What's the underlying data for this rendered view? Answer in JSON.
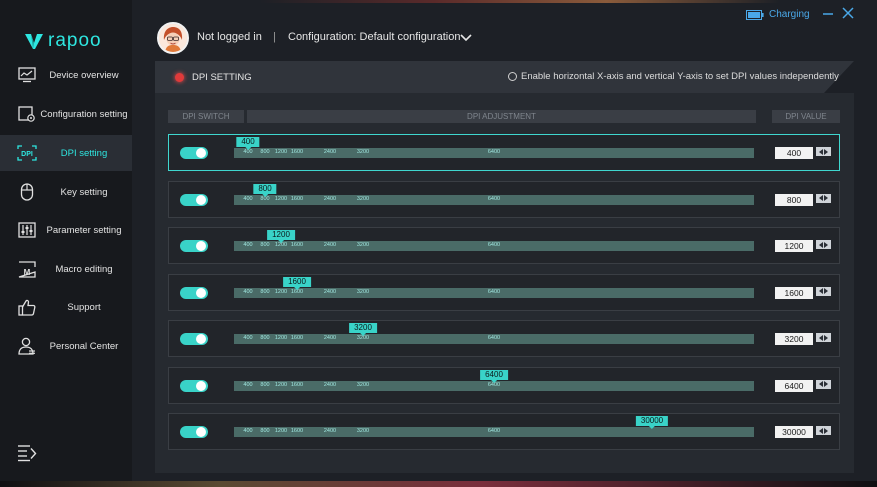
{
  "app": {
    "brand": "rapoo"
  },
  "sidebar": {
    "items": [
      {
        "label": "Device overview",
        "icon": "monitor-icon"
      },
      {
        "label": "Configuration setting",
        "icon": "config-icon"
      },
      {
        "label": "DPI setting",
        "icon": "dpi-icon",
        "active": true
      },
      {
        "label": "Key setting",
        "icon": "mouse-icon"
      },
      {
        "label": "Parameter setting",
        "icon": "sliders-icon"
      },
      {
        "label": "Macro editing",
        "icon": "macro-icon"
      },
      {
        "label": "Support",
        "icon": "thumbs-up-icon"
      },
      {
        "label": "Personal Center",
        "icon": "user-icon"
      }
    ]
  },
  "header": {
    "login_status": "Not logged in",
    "separator": "|",
    "configuration": "Configuration: Default configuration",
    "charging": "Charging"
  },
  "panel": {
    "title": "DPI SETTING",
    "independent_xy_label": "Enable horizontal X-axis and vertical Y-axis to set DPI values independently",
    "columns": {
      "switch": "DPI SWITCH",
      "adjustment": "DPI ADJUSTMENT",
      "value": "DPI VALUE"
    }
  },
  "dpi": {
    "max": 30000,
    "ticks": [
      {
        "label": "400",
        "value": 400
      },
      {
        "label": "800",
        "value": 800
      },
      {
        "label": "1200",
        "value": 1200
      },
      {
        "label": "1600",
        "value": 1600
      },
      {
        "label": "2400",
        "value": 2400
      },
      {
        "label": "3200",
        "value": 3200
      },
      {
        "label": "6400",
        "value": 6400
      }
    ],
    "levels": [
      {
        "value": 400,
        "label": "400",
        "enabled": true,
        "selected": true
      },
      {
        "value": 800,
        "label": "800",
        "enabled": true
      },
      {
        "value": 1200,
        "label": "1200",
        "enabled": true
      },
      {
        "value": 1600,
        "label": "1600",
        "enabled": true
      },
      {
        "value": 3200,
        "label": "3200",
        "enabled": true
      },
      {
        "value": 6400,
        "label": "6400",
        "enabled": true
      },
      {
        "value": 30000,
        "label": "30000",
        "enabled": true
      }
    ]
  },
  "colors": {
    "accent": "#39d3c8",
    "track": "#4a6b67",
    "record": "#e03a3a",
    "link": "#4aa8e8"
  }
}
